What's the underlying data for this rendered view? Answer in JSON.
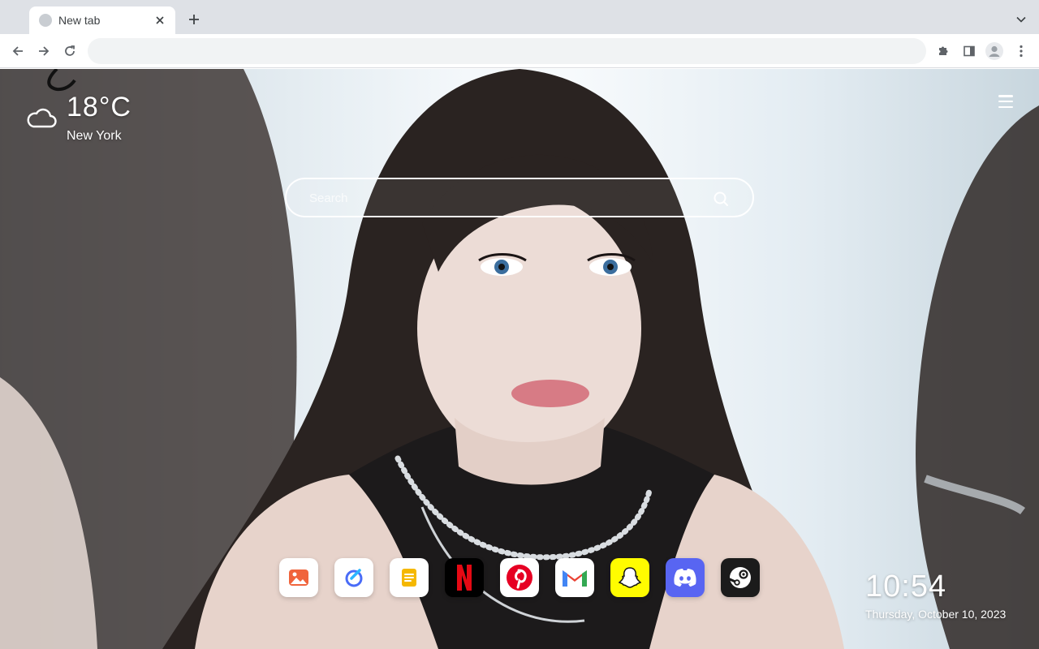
{
  "browser": {
    "tab": {
      "title": "New tab"
    },
    "omnibox": {
      "value": ""
    }
  },
  "weather": {
    "temperature": "18°C",
    "city": "New York",
    "icon": "cloud-icon"
  },
  "search": {
    "placeholder": "Search"
  },
  "dock": {
    "apps": [
      {
        "name": "Photos",
        "icon": "photos-icon",
        "bg": "#ffffff",
        "accent": "#f0643c"
      },
      {
        "name": "Tasks",
        "icon": "tasks-icon",
        "bg": "#ffffff",
        "accent": "#4a6cf7"
      },
      {
        "name": "Notes",
        "icon": "notes-icon",
        "bg": "#ffffff",
        "accent": "#f5b800"
      },
      {
        "name": "Netflix",
        "icon": "netflix-icon",
        "bg": "#000000",
        "accent": "#e50914"
      },
      {
        "name": "Pinterest",
        "icon": "pinterest-icon",
        "bg": "#ffffff",
        "accent": "#e60023"
      },
      {
        "name": "Gmail",
        "icon": "gmail-icon",
        "bg": "#ffffff",
        "accent": "#ea4335"
      },
      {
        "name": "Snapchat",
        "icon": "snapchat-icon",
        "bg": "#fffc00",
        "accent": "#ffffff"
      },
      {
        "name": "Discord",
        "icon": "discord-icon",
        "bg": "#5865f2",
        "accent": "#ffffff"
      },
      {
        "name": "Steam",
        "icon": "steam-icon",
        "bg": "#1b1b1b",
        "accent": "#ffffff"
      }
    ]
  },
  "clock": {
    "time": "10:54",
    "date": "Thursday, October 10, 2023"
  }
}
